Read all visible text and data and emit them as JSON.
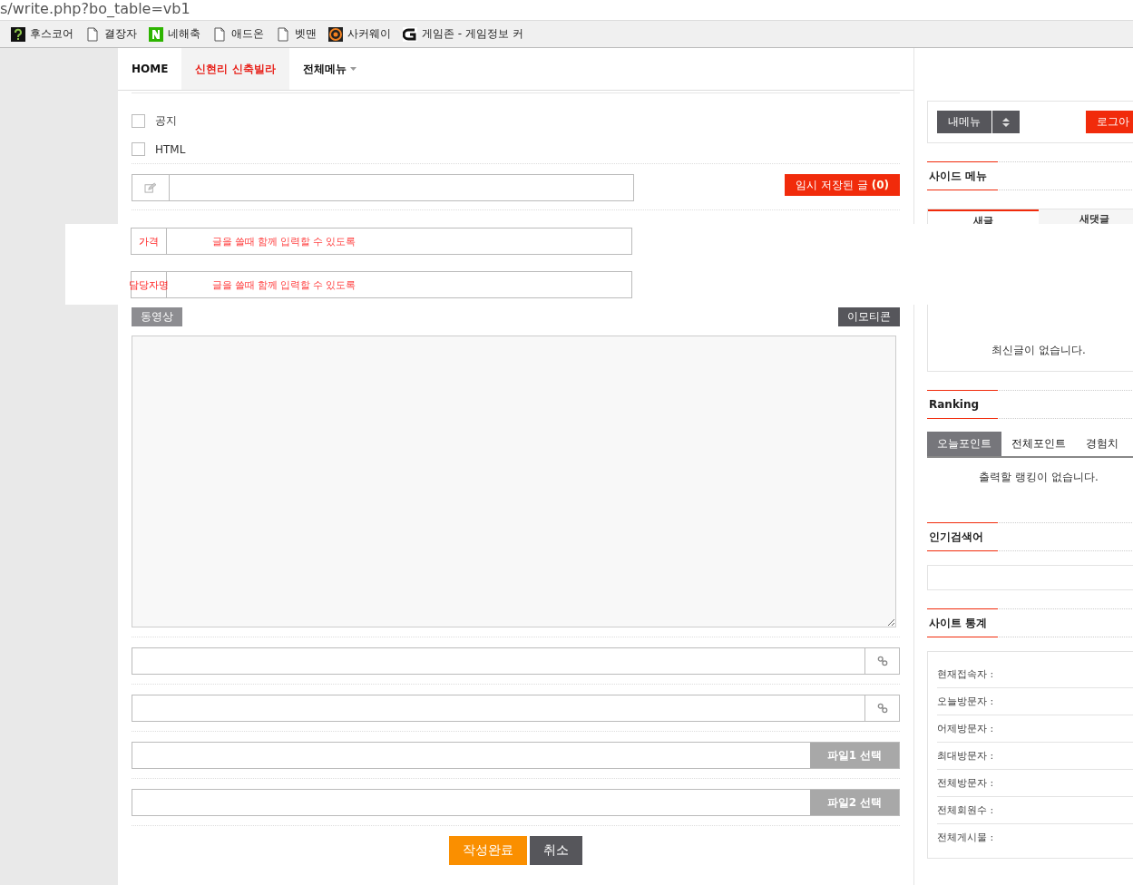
{
  "address_bar": {
    "url": "s/write.php?bo_table=vb1"
  },
  "bookmarks": [
    {
      "label": "후스코어",
      "kind": "question"
    },
    {
      "label": "결장자",
      "kind": "page"
    },
    {
      "label": "네해축",
      "kind": "n"
    },
    {
      "label": "애드온",
      "kind": "page"
    },
    {
      "label": "벳맨",
      "kind": "page"
    },
    {
      "label": "사커웨이",
      "kind": "ball"
    },
    {
      "label": "게임존 - 게임정보 커",
      "kind": "g"
    }
  ],
  "nav": [
    {
      "label": "HOME",
      "selected": false,
      "kind": "link"
    },
    {
      "label": "신현리 신축빌라",
      "selected": true,
      "kind": "link"
    },
    {
      "label": "전체메뉴",
      "selected": false,
      "kind": "dropdown"
    }
  ],
  "form": {
    "options": [
      {
        "label": "공지",
        "checked": false
      },
      {
        "label": "HTML",
        "checked": false
      }
    ],
    "temp_save_button": "임시 저장된 글 **(0)**",
    "extra_fields": [
      {
        "label": "가격",
        "placeholder": "글을 쓸때 함께 입력할 수 있도록"
      },
      {
        "label": "담당자명",
        "placeholder": "글을 쓸때 함께 입력할 수 있도록"
      }
    ],
    "video_button": "동영상",
    "emoticon_button": "이모티콘",
    "link_fields": [
      {
        "kind": "link"
      },
      {
        "kind": "link"
      }
    ],
    "file_fields": [
      {
        "button": "파일1 선택"
      },
      {
        "button": "파일2 선택"
      }
    ],
    "actions": [
      {
        "label": "작성완료",
        "kind": "submit"
      },
      {
        "label": "취소",
        "kind": "cancel"
      }
    ]
  },
  "sidebar": {
    "my_menu_button": "내메뉴",
    "logout_button": "로그아",
    "side_menu_heading": "사이드 메뉴",
    "latest_tabs": [
      {
        "label": "새글",
        "selected": true
      },
      {
        "label": "새댓글",
        "selected": false
      }
    ],
    "latest_empty": "최신글이 없습니다.",
    "ranking_heading": "Ranking",
    "ranking_tabs": [
      {
        "label": "오늘포인트",
        "selected": true
      },
      {
        "label": "전체포인트",
        "selected": false
      },
      {
        "label": "경험치",
        "selected": false
      }
    ],
    "ranking_empty": "출력할 랭킹이 없습니다.",
    "popular_heading": "인기검색어",
    "stats_heading": "사이트 통계",
    "stats": [
      "현재접속자 :",
      "오늘방문자 :",
      "어제방문자 :",
      "최대방문자 :",
      "전체방문자 :",
      "전체회원수 :",
      "전체게시물 :"
    ]
  }
}
